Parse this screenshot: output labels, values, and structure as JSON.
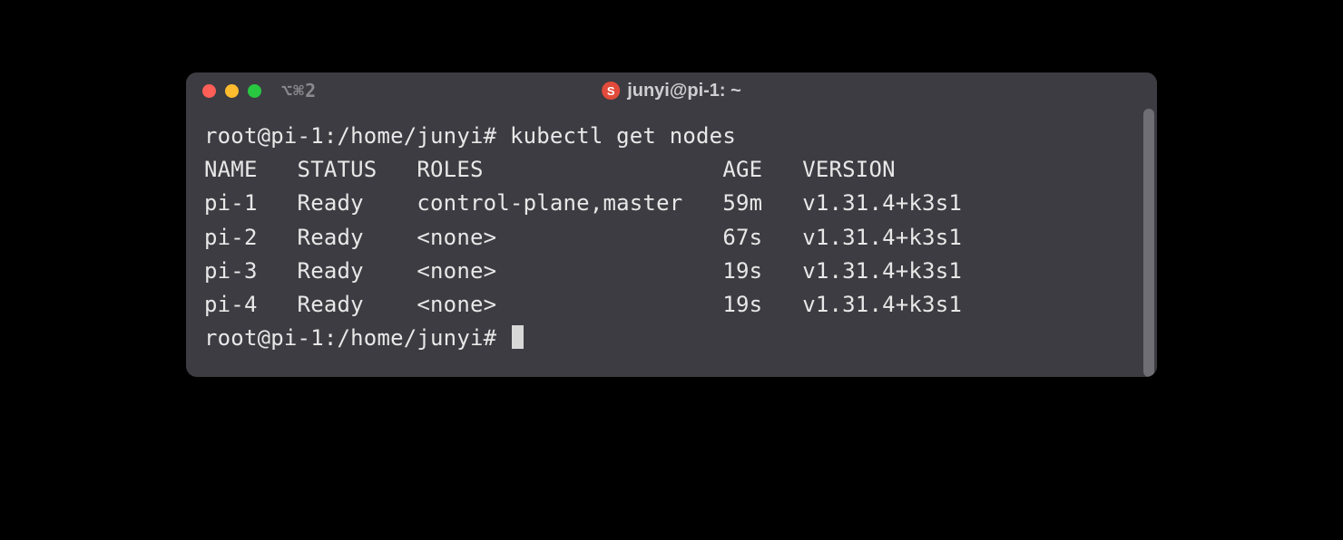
{
  "titlebar": {
    "hotkey_hint": "⌥⌘2",
    "badge_letter": "S",
    "window_title": "junyi@pi-1: ~"
  },
  "prompt1": "root@pi-1:/home/junyi# ",
  "command": "kubectl get nodes",
  "prompt2": "root@pi-1:/home/junyi# ",
  "table": {
    "header": "NAME   STATUS   ROLES                  AGE   VERSION",
    "rows": [
      "pi-1   Ready    control-plane,master   59m   v1.31.4+k3s1",
      "pi-2   Ready    <none>                 67s   v1.31.4+k3s1",
      "pi-3   Ready    <none>                 19s   v1.31.4+k3s1",
      "pi-4   Ready    <none>                 19s   v1.31.4+k3s1"
    ]
  }
}
